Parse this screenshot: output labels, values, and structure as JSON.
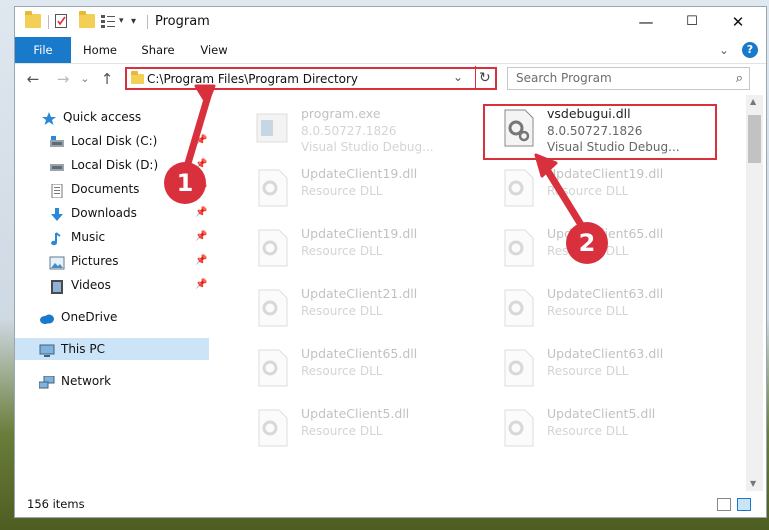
{
  "window": {
    "title": "Program",
    "controls": {
      "minimize": "—",
      "maximize": "☐",
      "close": "✕"
    }
  },
  "ribbon": {
    "tabs": [
      "File",
      "Home",
      "Share",
      "View"
    ],
    "expand": "⌄",
    "help": "?"
  },
  "nav": {
    "back": "←",
    "forward": "→",
    "dropdown": "⌄",
    "up": "↑",
    "address": "C:\\Program Files\\Program Directory",
    "refresh": "↻"
  },
  "search": {
    "placeholder": "Search Program",
    "icon": "⌕"
  },
  "sidebar": {
    "quick_access": "Quick access",
    "items": [
      {
        "label": "Local Disk (C:)",
        "icon": "drive-icon",
        "pinned": true
      },
      {
        "label": "Local Disk (D:)",
        "icon": "drive-icon",
        "pinned": true
      },
      {
        "label": "Documents",
        "icon": "document-icon",
        "pinned": true
      },
      {
        "label": "Downloads",
        "icon": "download-icon",
        "pinned": true
      },
      {
        "label": "Music",
        "icon": "music-icon",
        "pinned": true
      },
      {
        "label": "Pictures",
        "icon": "pictures-icon",
        "pinned": true
      },
      {
        "label": "Videos",
        "icon": "video-icon",
        "pinned": true
      }
    ],
    "onedrive": "OneDrive",
    "thispc": "This PC",
    "network": "Network"
  },
  "files": [
    {
      "name": "program.exe",
      "line2": "8.0.50727.1826",
      "line3": "Visual Studio Debug..."
    },
    {
      "name": "vsdebugui.dll",
      "line2": "8.0.50727.1826",
      "line3": "Visual Studio Debug..."
    },
    {
      "name": "UpdateClient19.dll",
      "line2": "Resource DLL"
    },
    {
      "name": "UpdateClient19.dll",
      "line2": "Resource DLL"
    },
    {
      "name": "UpdateClient19.dll",
      "line2": "Resource DLL"
    },
    {
      "name": "UpdateClient65.dll",
      "line2": "Resource DLL"
    },
    {
      "name": "UpdateClient21.dll",
      "line2": "Resource DLL"
    },
    {
      "name": "UpdateClient63.dll",
      "line2": "Resource DLL"
    },
    {
      "name": "UpdateClient65.dll",
      "line2": "Resource DLL"
    },
    {
      "name": "UpdateClient63.dll",
      "line2": "Resource DLL"
    },
    {
      "name": "UpdateClient5.dll",
      "line2": "Resource DLL"
    },
    {
      "name": "UpdateClient5.dll",
      "line2": "Resource DLL"
    }
  ],
  "status": {
    "items": "156 items"
  },
  "callouts": [
    "1",
    "2"
  ],
  "colors": {
    "accent": "#1979ca",
    "highlight": "#d9303e",
    "selected": "#cce4f7"
  }
}
